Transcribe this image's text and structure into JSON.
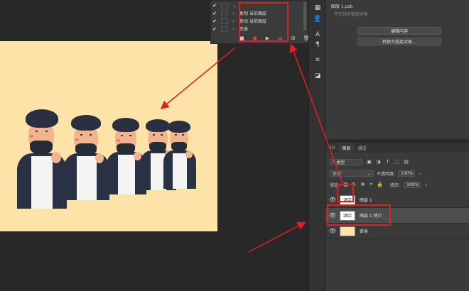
{
  "actions": {
    "rows": [
      {
        "label": "",
        "checked": true
      },
      {
        "label": "复制 当前图层",
        "checked": true
      },
      {
        "label": "移动 当前图层",
        "checked": true
      },
      {
        "label": "变换",
        "checked": true
      }
    ]
  },
  "properties": {
    "title": "图层 1.psb",
    "subtitle": "不支持的智能对象",
    "edit_button": "编辑内容",
    "convert_button": "转换为链接对象..."
  },
  "layers_panel": {
    "tabs": [
      "3D",
      "图层",
      "通道"
    ],
    "active_tab": "图层",
    "filter_type": "类型",
    "blend_mode": "正常",
    "opacity_label": "不透明度:",
    "opacity_value": "100%",
    "lock_label": "锁定:",
    "fill_label": "填充:",
    "fill_value": "100%",
    "layers": [
      {
        "name": "图层 1",
        "thumb_text": "酒店",
        "selected": false
      },
      {
        "name": "图层 1 拷贝",
        "thumb_text": "酒店",
        "selected": true
      },
      {
        "name": "背景",
        "thumb_text": "",
        "selected": false
      }
    ]
  },
  "colors": {
    "accent_red": "#e02020",
    "canvas_bg": "#fde3a7",
    "panel_bg": "#3a3a3a"
  }
}
